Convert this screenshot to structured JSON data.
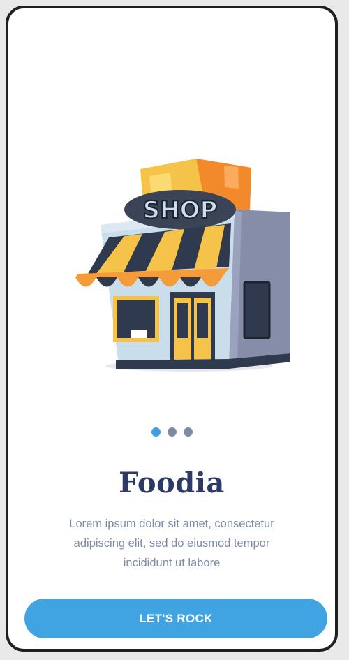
{
  "onboarding": {
    "illustration": {
      "icon": "shop-storefront-illustration",
      "sign_text": "SHOP"
    },
    "pagination": {
      "total": 3,
      "active_index": 0
    },
    "title": "Foodia",
    "description": "Lorem ipsum dolor sit amet, consectetur adipiscing elit, sed do eiusmod tempor incididunt ut labore",
    "cta_label": "LET'S ROCK"
  },
  "colors": {
    "accent": "#40a4e2",
    "title": "#2d3a66",
    "muted": "#7f8aa5",
    "dot_inactive": "#7f8aa5"
  }
}
